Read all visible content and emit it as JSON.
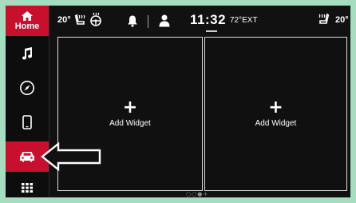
{
  "sidebar": {
    "home_label": "Home",
    "items": [
      {
        "icon": "music-note-icon"
      },
      {
        "icon": "compass-icon"
      },
      {
        "icon": "phone-icon"
      },
      {
        "icon": "car-icon"
      },
      {
        "icon": "apps-grid-icon"
      }
    ]
  },
  "status": {
    "left_temp": "20°",
    "right_temp": "20°",
    "clock": "11:32",
    "ext_temp": "72°EXT"
  },
  "widgets": {
    "left": {
      "label": "Add Widget",
      "plus": "+"
    },
    "right": {
      "label": "Add Widget",
      "plus": "+"
    }
  },
  "pager": "○○●+",
  "colors": {
    "accent": "#c8102e",
    "background": "#111111",
    "frame": "#a6dcbf"
  }
}
